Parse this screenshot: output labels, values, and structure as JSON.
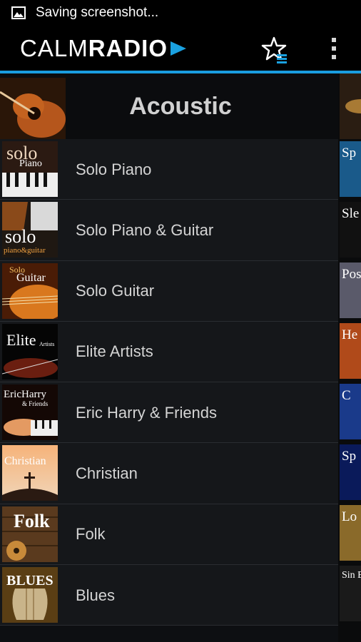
{
  "status_bar": {
    "text": "Saving screenshot..."
  },
  "app": {
    "logo_part1": "CALM",
    "logo_part2": "RADIO"
  },
  "header": {
    "title": "Acoustic"
  },
  "channels": [
    {
      "label": "Solo Piano",
      "art_text": "solo",
      "art_sub": "Piano"
    },
    {
      "label": "Solo Piano & Guitar",
      "art_text": "solo",
      "art_sub": "piano&guitar"
    },
    {
      "label": "Solo Guitar",
      "art_text": "Solo",
      "art_sub": "Guitar"
    },
    {
      "label": "Elite Artists",
      "art_text": "Elite",
      "art_sub": "Artists"
    },
    {
      "label": "Eric Harry & Friends",
      "art_text": "EricHarry",
      "art_sub": "& Friends"
    },
    {
      "label": "Christian",
      "art_text": "Christian",
      "art_sub": ""
    },
    {
      "label": "Folk",
      "art_text": "Folk",
      "art_sub": ""
    },
    {
      "label": "Blues",
      "art_text": "BLUES",
      "art_sub": ""
    }
  ],
  "peek_items": [
    "Sp",
    "Sle",
    "Pos",
    "He",
    "C",
    "Sp",
    "Lo",
    "Sin B"
  ]
}
